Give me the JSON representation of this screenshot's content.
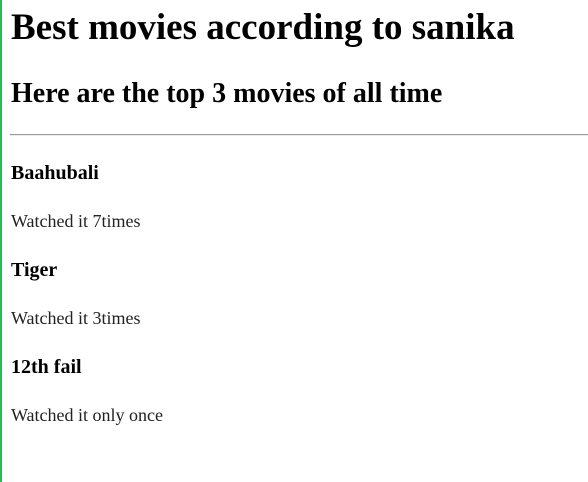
{
  "page": {
    "title": "Best movies according to sanika",
    "subtitle": "Here are the top 3 movies of all time"
  },
  "movies": [
    {
      "name": "Baahubali",
      "note": "Watched it 7times"
    },
    {
      "name": "Tiger",
      "note": "Watched it 3times"
    },
    {
      "name": "12th fail",
      "note": "Watched it only once"
    }
  ],
  "colors": {
    "left_edge": "#2fb55a",
    "text": "#000000",
    "divider": "#9a9a9a"
  }
}
